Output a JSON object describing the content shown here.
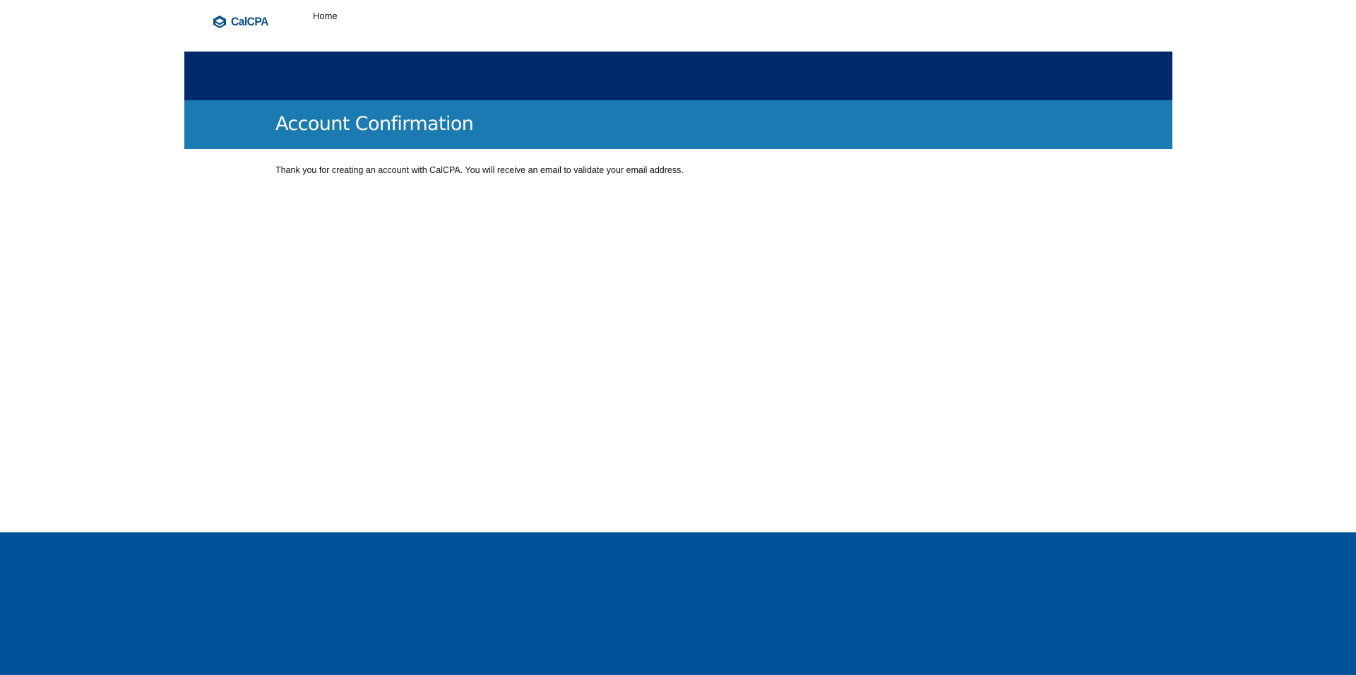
{
  "header": {
    "logo_text": "CalCPA",
    "nav_home_label": "Home"
  },
  "main": {
    "page_title": "Account Confirmation",
    "message": "Thank you for creating an account with CalCPA. You will receive an email to validate your email address."
  },
  "colors": {
    "brand_blue": "#0a4d8c",
    "dark_band": "#002a6c",
    "title_band": "#1b7ab1",
    "footer": "#00529b"
  },
  "icons": {
    "logo_mark": "calcpa-logo-icon"
  }
}
